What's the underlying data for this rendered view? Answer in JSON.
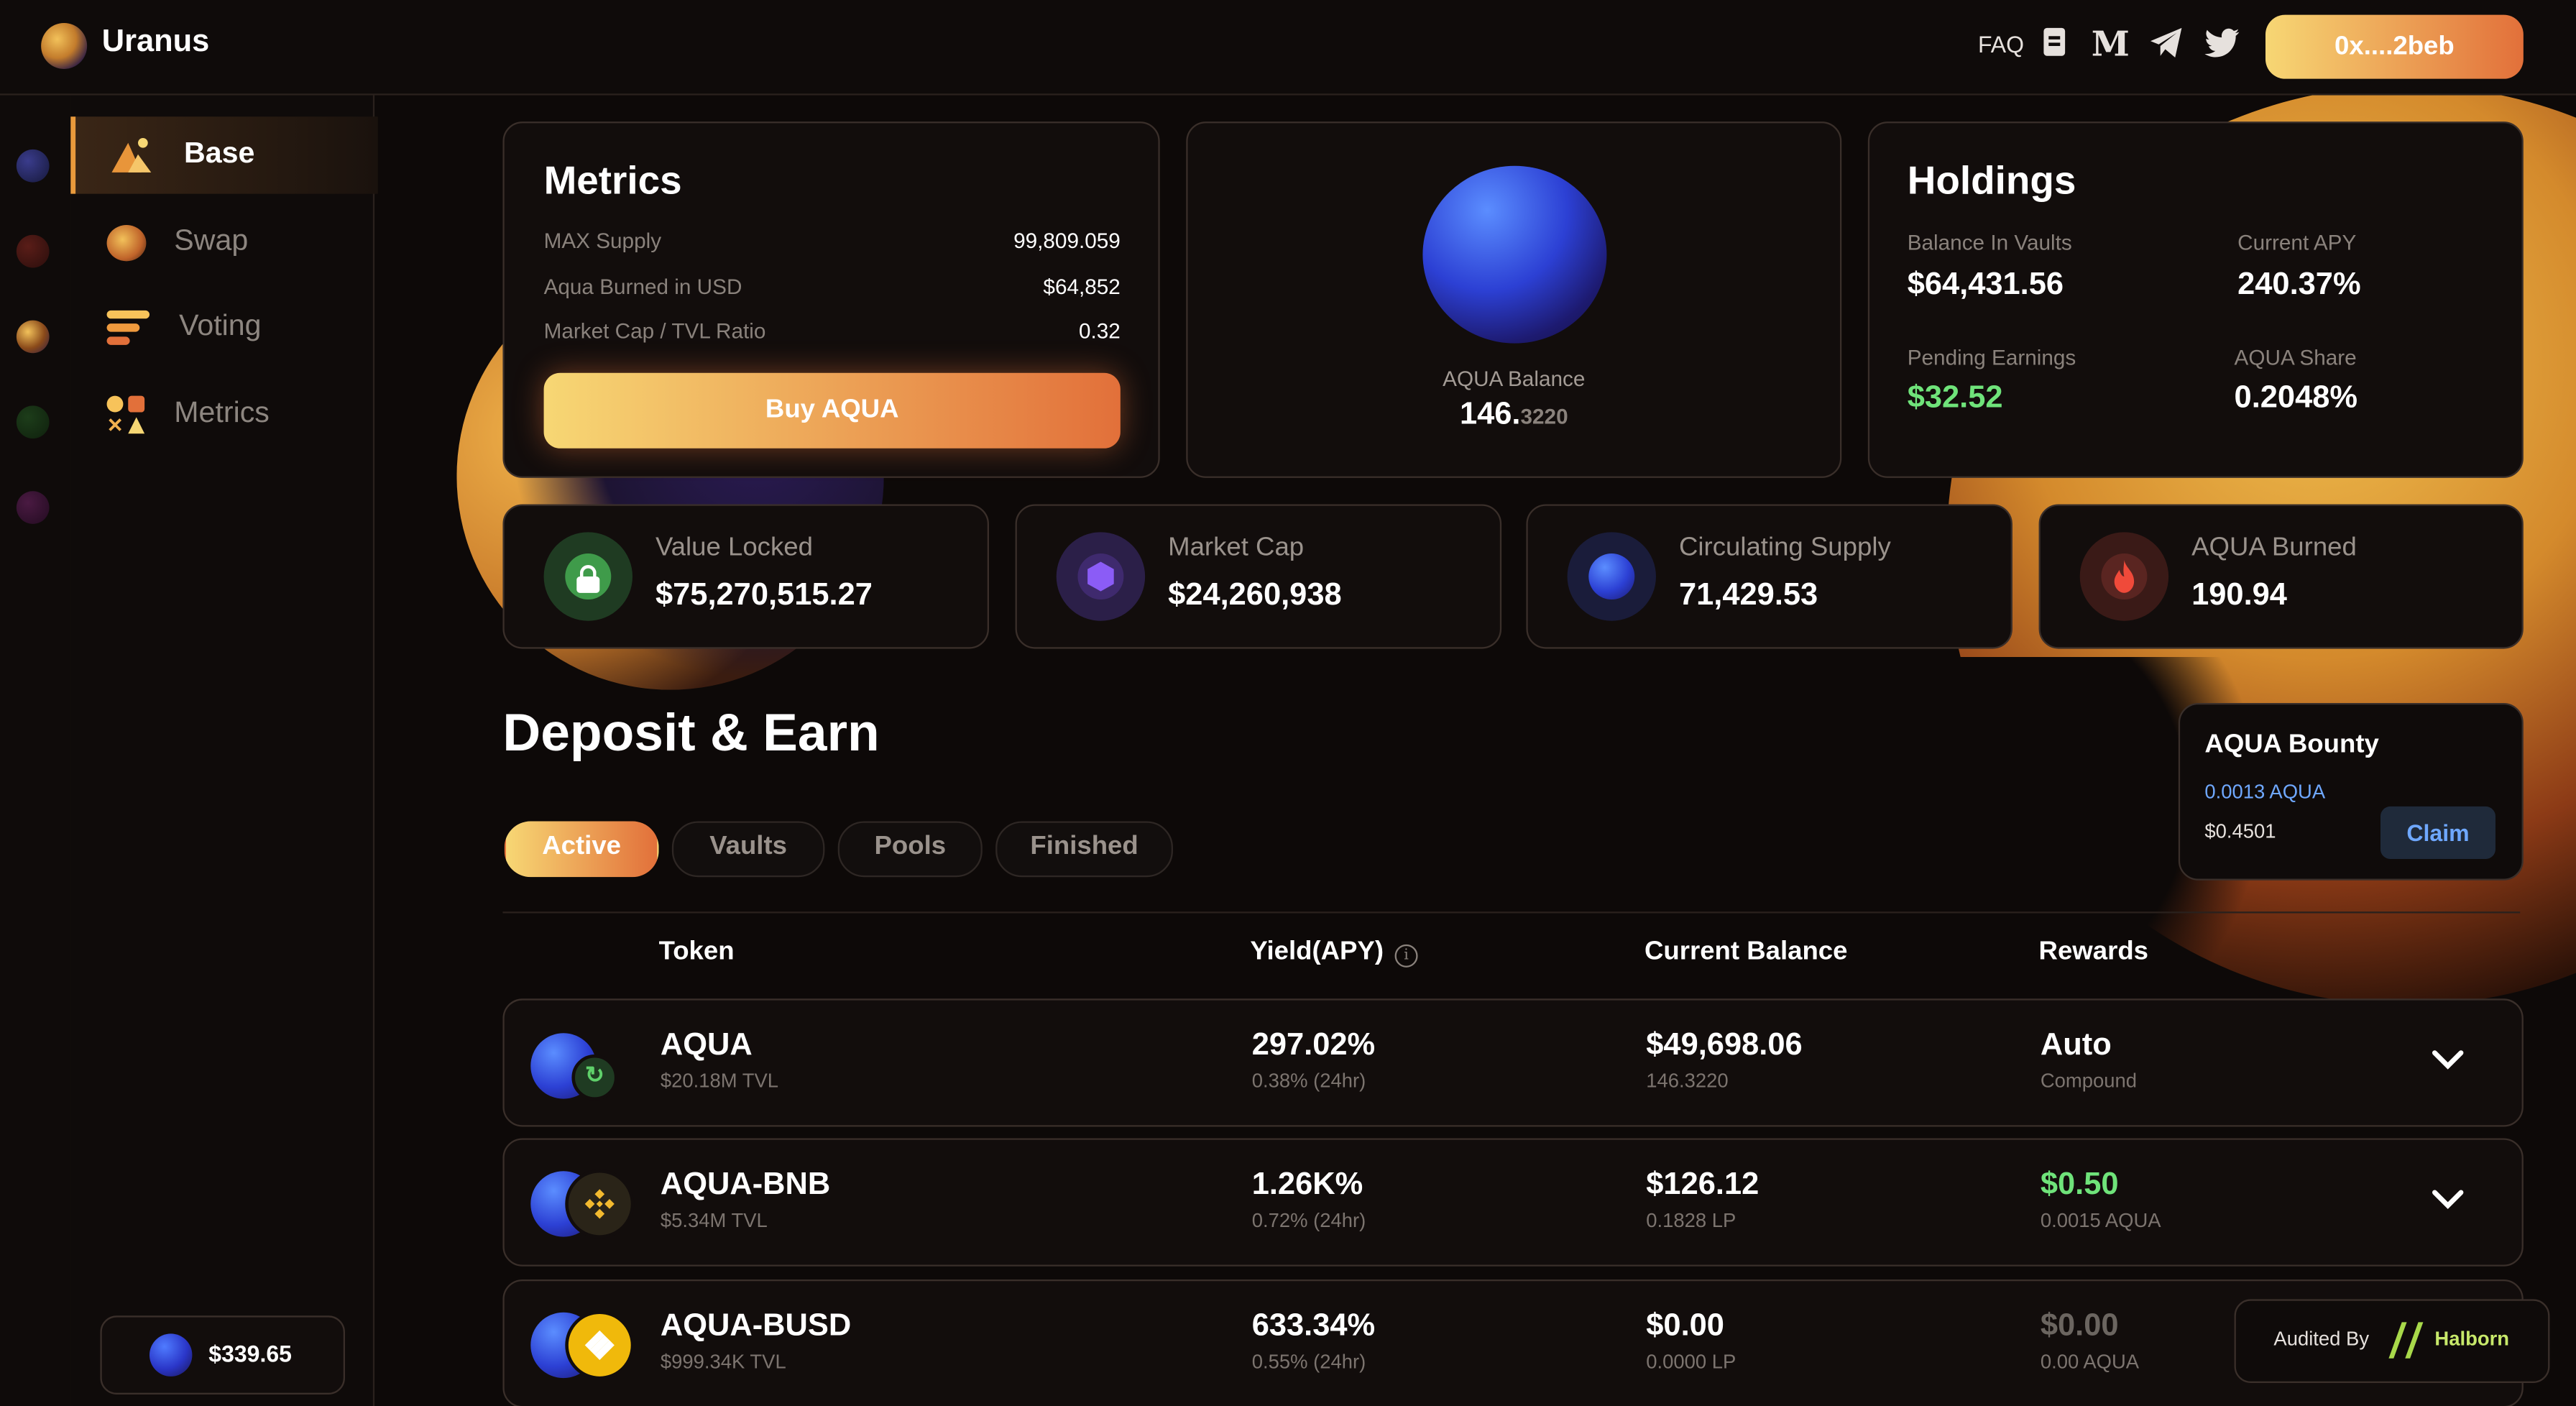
{
  "app": {
    "name": "Uranus"
  },
  "header": {
    "links": [
      "FAQ"
    ],
    "wallet_label": "0x....2beb"
  },
  "sidebar": {
    "items": [
      {
        "label": "Base",
        "active": true
      },
      {
        "label": "Swap"
      },
      {
        "label": "Voting"
      },
      {
        "label": "Metrics"
      }
    ],
    "price": "$339.65"
  },
  "metrics": {
    "title": "Metrics",
    "rows": [
      {
        "label": "MAX Supply",
        "value": "99,809.059"
      },
      {
        "label": "Aqua Burned in USD",
        "value": "$64,852"
      },
      {
        "label": "Market Cap / TVL Ratio",
        "value": "0.32"
      }
    ],
    "buy_label": "Buy AQUA"
  },
  "balance": {
    "label": "AQUA Balance",
    "value_main": "146.",
    "value_decimals": "3220"
  },
  "holdings": {
    "title": "Holdings",
    "items": [
      {
        "label": "Balance In Vaults",
        "value": "$64,431.56"
      },
      {
        "label": "Current APY",
        "value": "240.37%"
      },
      {
        "label": "Pending Earnings",
        "value": "$32.52"
      },
      {
        "label": "AQUA Share",
        "value": "0.2048%"
      }
    ]
  },
  "stats": [
    {
      "label": "Value Locked",
      "value": "$75,270,515.27",
      "icon": "lock-icon"
    },
    {
      "label": "Market Cap",
      "value": "$24,260,938",
      "icon": "hexagon-icon"
    },
    {
      "label": "Circulating Supply",
      "value": "71,429.53",
      "icon": "aqua-orb-icon"
    },
    {
      "label": "AQUA Burned",
      "value": "190.94",
      "icon": "flame-icon"
    }
  ],
  "deposit": {
    "title": "Deposit & Earn",
    "tabs": [
      "Active",
      "Vaults",
      "Pools",
      "Finished"
    ],
    "columns": [
      "Token",
      "Yield(APY)",
      "Current Balance",
      "Rewards"
    ]
  },
  "bounty": {
    "title": "AQUA Bounty",
    "amount": "0.0013 AQUA",
    "usd": "$0.4501",
    "claim_label": "Claim"
  },
  "rows": [
    {
      "token": "AQUA",
      "tvl": "$20.18M TVL",
      "apy": "297.02%",
      "apy_24h": "0.38% (24hr)",
      "balance": "$49,698.06",
      "balance_sub": "146.3220",
      "rewards": "Auto",
      "rewards_sub": "Compound",
      "rewards_color": "#ffffff"
    },
    {
      "token": "AQUA-BNB",
      "tvl": "$5.34M TVL",
      "apy": "1.26K%",
      "apy_24h": "0.72% (24hr)",
      "balance": "$126.12",
      "balance_sub": "0.1828 LP",
      "rewards": "$0.50",
      "rewards_sub": "0.0015 AQUA",
      "rewards_color": "#6fe37a"
    },
    {
      "token": "AQUA-BUSD",
      "tvl": "$999.34K TVL",
      "apy": "633.34%",
      "apy_24h": "0.55% (24hr)",
      "balance": "$0.00",
      "balance_sub": "0.0000 LP",
      "rewards": "$0.00",
      "rewards_sub": "0.00 AQUA",
      "rewards_color": "#6b6560"
    }
  ],
  "audit": {
    "label": "Audited By",
    "brand": "Halborn"
  },
  "colors": {
    "accent_start": "#f7d774",
    "accent_end": "#e2703a",
    "green": "#6fe37a",
    "blue_link": "#6fa8ff"
  }
}
